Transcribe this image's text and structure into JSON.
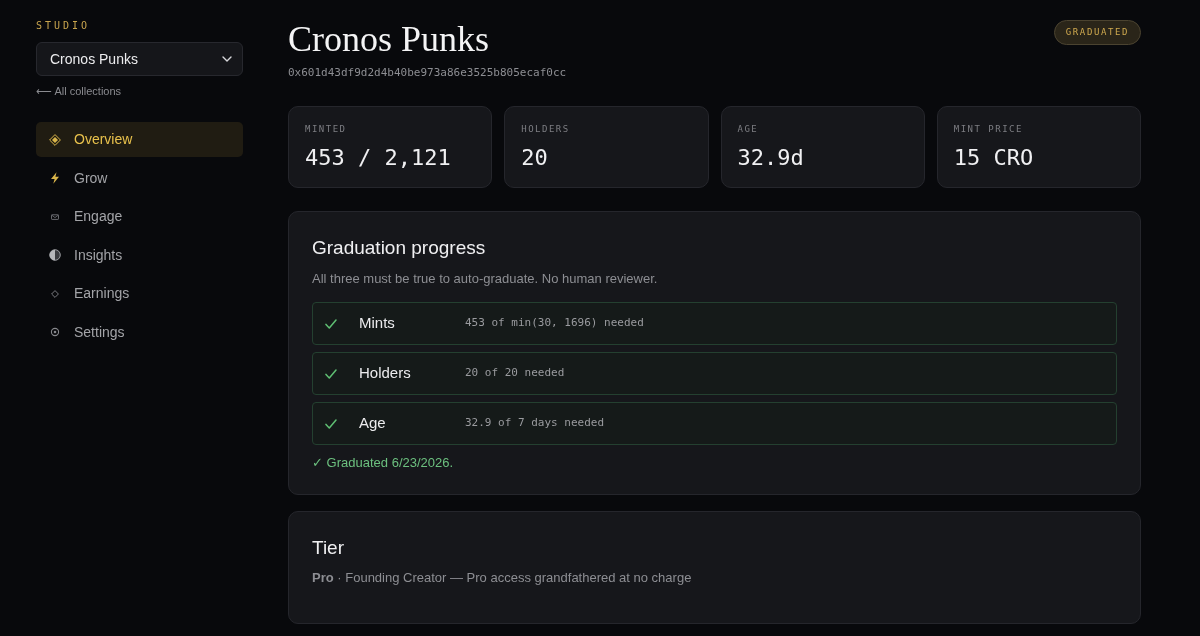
{
  "sidebar": {
    "section_label": "STUDIO",
    "collection_select": {
      "value": "Cronos Punks"
    },
    "back_link": "⟵ All collections",
    "items": [
      {
        "label": "Overview",
        "selected": true
      },
      {
        "label": "Grow",
        "selected": false
      },
      {
        "label": "Engage",
        "selected": false
      },
      {
        "label": "Insights",
        "selected": false
      },
      {
        "label": "Earnings",
        "selected": false
      },
      {
        "label": "Settings",
        "selected": false
      }
    ]
  },
  "header": {
    "title": "Cronos Punks",
    "address": "0x601d43df9d2d4b40be973a86e3525b805ecaf0cc",
    "status_badge": "GRADUATED"
  },
  "stats": [
    {
      "label": "MINTED",
      "value": "453 / 2,121"
    },
    {
      "label": "HOLDERS",
      "value": "20"
    },
    {
      "label": "AGE",
      "value": "32.9d"
    },
    {
      "label": "MINT PRICE",
      "value": "15 CRO"
    }
  ],
  "graduation": {
    "title": "Graduation progress",
    "description": "All three must be true to auto-graduate. No human reviewer.",
    "criteria": [
      {
        "name": "Mints",
        "detail": "453 of min(30, 1696) needed",
        "met": true
      },
      {
        "name": "Holders",
        "detail": "20 of 20 needed",
        "met": true
      },
      {
        "name": "Age",
        "detail": "32.9 of 7 days needed",
        "met": true
      }
    ],
    "result": "✓ Graduated 6/23/2026."
  },
  "tier": {
    "title": "Tier",
    "description": "**Pro** · Founding Creator — Pro access grandfathered at no charge"
  }
}
